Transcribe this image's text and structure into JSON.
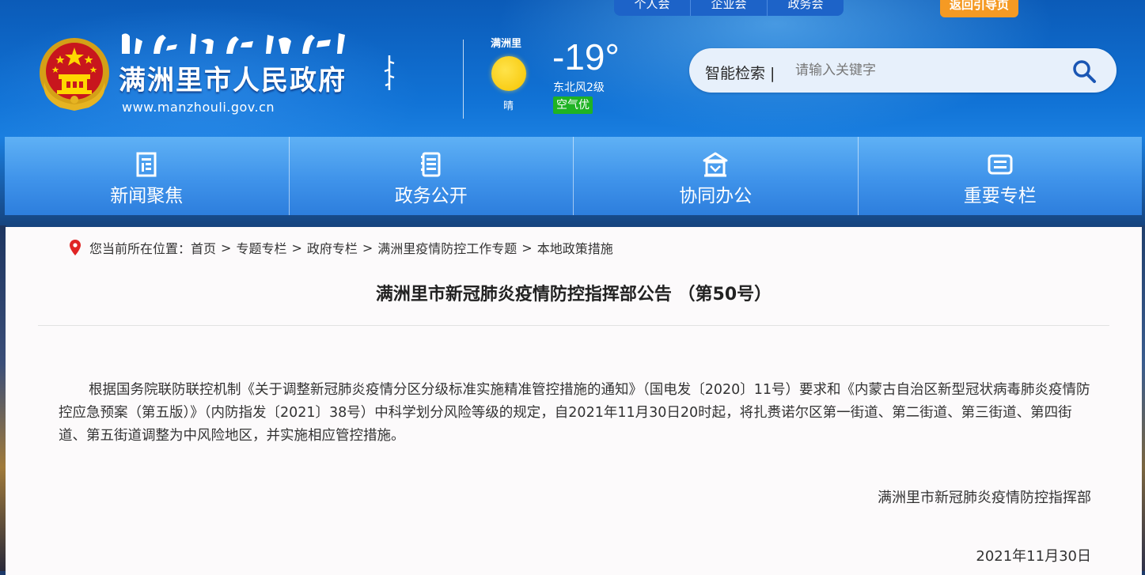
{
  "header": {
    "top_tabs": [
      "个人会",
      "企业会",
      "政务会"
    ],
    "guide_button": "返回引导页",
    "site_name": "满洲里市人民政府",
    "site_url": "www.manzhouli.gov.cn"
  },
  "weather": {
    "city": "满洲里",
    "condition": "晴",
    "temperature": "-19°",
    "wind": "东北风2级",
    "air_quality": "空气优"
  },
  "search": {
    "label": "智能检索 |",
    "placeholder": "请输入关键字",
    "button_icon": "search-icon"
  },
  "nav": {
    "items": [
      {
        "label": "新闻聚焦",
        "icon": "news-icon"
      },
      {
        "label": "政务公开",
        "icon": "document-list-icon"
      },
      {
        "label": "协同办公",
        "icon": "building-icon"
      },
      {
        "label": "重要专栏",
        "icon": "card-icon"
      }
    ]
  },
  "breadcrumb": {
    "prefix": "您当前所在位置：",
    "items": [
      "首页",
      "专题专栏",
      "政府专栏",
      "满洲里疫情防控工作专题",
      "本地政策措施"
    ],
    "separator": ">"
  },
  "article": {
    "title": "满洲里市新冠肺炎疫情防控指挥部公告 （第50号）",
    "body": "根据国务院联防联控机制《关于调整新冠肺炎疫情分区分级标准实施精准管控措施的通知》（国电发〔2020〕11号）要求和《内蒙古自治区新型冠状病毒肺炎疫情防控应急预案（第五版）》（内防指发〔2021〕38号）中科学划分风险等级的规定，自2021年11月30日20时起，将扎赉诺尔区第一街道、第二街道、第三街道、第四街道、第五街道调整为中风险地区，并实施相应管控措施。",
    "signature": "满洲里市新冠肺炎疫情防控指挥部",
    "date": "2021年11月30日"
  },
  "colors": {
    "header_blue": "#1173d6",
    "nav_blue": "#3f93ea",
    "guide_orange": "#f59a23",
    "aqi_green": "#1fb323",
    "pin_red": "#e02424"
  }
}
